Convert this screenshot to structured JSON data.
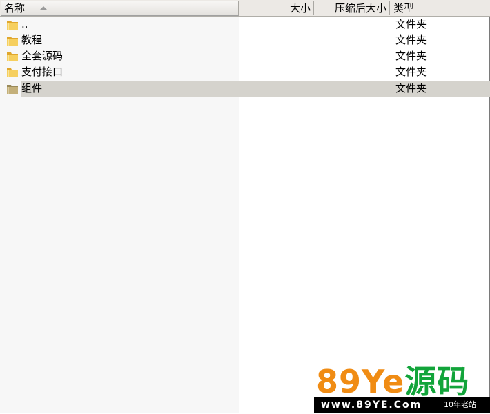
{
  "header": {
    "name": "名称",
    "size": "大小",
    "compressed_size": "压缩后大小",
    "type": "类型"
  },
  "rows": [
    {
      "name": "..",
      "type": "文件夹",
      "selected": false
    },
    {
      "name": "教程",
      "type": "文件夹",
      "selected": false
    },
    {
      "name": "全套源码",
      "type": "文件夹",
      "selected": false
    },
    {
      "name": "支付接口",
      "type": "文件夹",
      "selected": false
    },
    {
      "name": "组件",
      "type": "文件夹",
      "selected": true
    }
  ],
  "watermark": {
    "logo_num": "89Ye",
    "logo_cn": "源码",
    "url": "www.89YE.Com",
    "tagline": "10年老站"
  },
  "colors": {
    "selection": "#d5d3cd",
    "folder": "#f2c14e",
    "logo_orange": "#f08c14",
    "logo_green": "#12a43a"
  }
}
